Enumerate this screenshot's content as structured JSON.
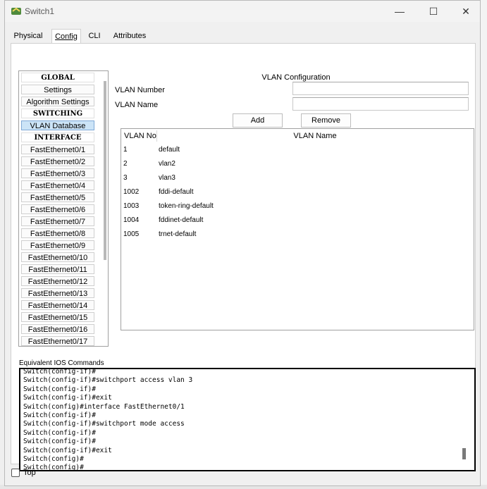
{
  "window": {
    "title": "Switch1",
    "minimize_glyph": "—",
    "maximize_glyph": "☐",
    "close_glyph": "✕"
  },
  "tabs": [
    {
      "label": "Physical"
    },
    {
      "label": "Config"
    },
    {
      "label": "CLI"
    },
    {
      "label": "Attributes"
    }
  ],
  "sidebar": {
    "items": [
      {
        "label": "GLOBAL"
      },
      {
        "label": "Settings"
      },
      {
        "label": "Algorithm Settings"
      },
      {
        "label": "SWITCHING"
      },
      {
        "label": "VLAN Database"
      },
      {
        "label": "INTERFACE"
      },
      {
        "label": "FastEthernet0/1"
      },
      {
        "label": "FastEthernet0/2"
      },
      {
        "label": "FastEthernet0/3"
      },
      {
        "label": "FastEthernet0/4"
      },
      {
        "label": "FastEthernet0/5"
      },
      {
        "label": "FastEthernet0/6"
      },
      {
        "label": "FastEthernet0/7"
      },
      {
        "label": "FastEthernet0/8"
      },
      {
        "label": "FastEthernet0/9"
      },
      {
        "label": "FastEthernet0/10"
      },
      {
        "label": "FastEthernet0/11"
      },
      {
        "label": "FastEthernet0/12"
      },
      {
        "label": "FastEthernet0/13"
      },
      {
        "label": "FastEthernet0/14"
      },
      {
        "label": "FastEthernet0/15"
      },
      {
        "label": "FastEthernet0/16"
      },
      {
        "label": "FastEthernet0/17"
      }
    ]
  },
  "vlan_config": {
    "title": "VLAN Configuration",
    "number_label": "VLAN Number",
    "number_value": "",
    "name_label": "VLAN Name",
    "name_value": "",
    "add_label": "Add",
    "remove_label": "Remove",
    "table": {
      "col_no": "VLAN No",
      "col_name": "VLAN Name",
      "rows": [
        {
          "no": "1",
          "name": "default"
        },
        {
          "no": "2",
          "name": "vlan2"
        },
        {
          "no": "3",
          "name": "vlan3"
        },
        {
          "no": "1002",
          "name": "fddi-default"
        },
        {
          "no": "1003",
          "name": "token-ring-default"
        },
        {
          "no": "1004",
          "name": "fddinet-default"
        },
        {
          "no": "1005",
          "name": "trnet-default"
        }
      ]
    }
  },
  "ios": {
    "label": "Equivalent IOS Commands",
    "lines": [
      "Switch(config-if)#",
      "Switch(config-if)#switchport access vlan 3",
      "Switch(config-if)#",
      "Switch(config-if)#exit",
      "Switch(config)#interface FastEthernet0/1",
      "Switch(config-if)#",
      "Switch(config-if)#switchport mode access",
      "Switch(config-if)#",
      "Switch(config-if)#",
      "Switch(config-if)#exit",
      "Switch(config)#",
      "Switch(config)#"
    ]
  },
  "footer": {
    "top_label": "Top",
    "top_checked": false
  }
}
